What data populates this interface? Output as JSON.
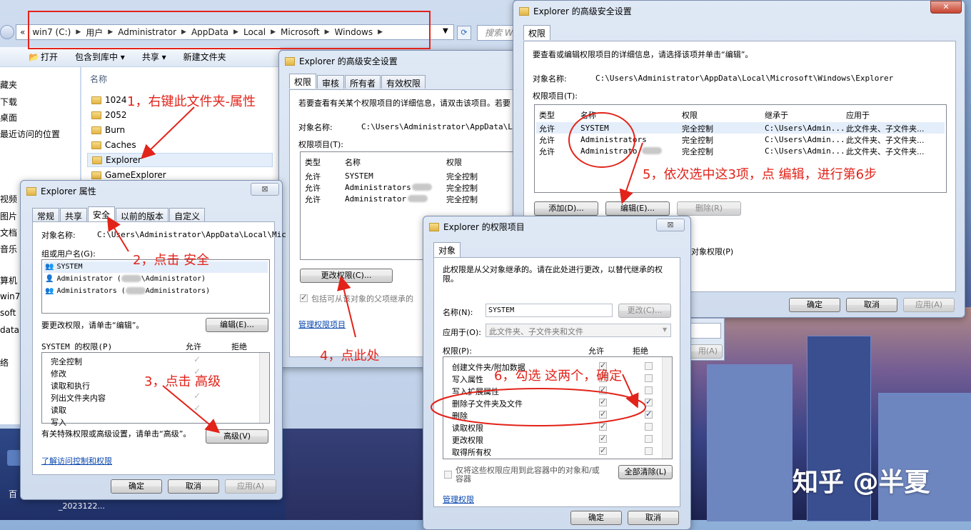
{
  "explorer": {
    "address_segments": [
      "win7 (C:)",
      "用户",
      "Administrator",
      "AppData",
      "Local",
      "Microsoft",
      "Windows"
    ],
    "address_prefix": "«",
    "search_placeholder": "搜索 W",
    "toolbar": [
      "打开",
      "包含到库中 ▾",
      "共享 ▾",
      "新建文件夹"
    ],
    "sidebar_items": [
      "藏夹",
      "下载",
      "桌面",
      "最近访问的位置",
      "视频",
      "图片",
      "文档",
      "音乐",
      "算机",
      "win7",
      "soft",
      "data",
      "络"
    ],
    "column_name": "名称",
    "files": [
      "1024",
      "2052",
      "Burn",
      "Caches",
      "Explorer",
      "GameExplorer"
    ],
    "taskbar_labels": [
      "百",
      "_2023122..."
    ]
  },
  "props_dialog": {
    "title": "Explorer 属性",
    "close": "⊠",
    "tabs": [
      "常规",
      "共享",
      "安全",
      "以前的版本",
      "自定义"
    ],
    "object_label": "对象名称:",
    "object_path": "C:\\Users\\Administrator\\AppData\\Local\\Mic",
    "group_label": "组或用户名(G):",
    "users": [
      "SYSTEM",
      "Administrator (",
      "Administrators ("
    ],
    "users_suffix": [
      "",
      "\\Administrator)",
      "Administrators)"
    ],
    "edit_hint": "要更改权限，请单击“编辑”。",
    "edit_button": "编辑(E)...",
    "perm_label": "SYSTEM 的权限(P)",
    "allow": "允许",
    "deny": "拒绝",
    "perms": [
      "完全控制",
      "修改",
      "读取和执行",
      "列出文件夹内容",
      "读取",
      "写入"
    ],
    "advanced_hint": "有关特殊权限或高级设置，请单击“高级”。",
    "advanced_button": "高级(V)",
    "learn_link": "了解访问控制和权限",
    "ok": "确定",
    "cancel": "取消",
    "apply": "应用(A)"
  },
  "adv_dialog1": {
    "title": "Explorer 的高级安全设置",
    "tabs": [
      "权限",
      "审核",
      "所有者",
      "有效权限"
    ],
    "hint": "若要查看有关某个权限项目的详细信息，请双击该项目。若要",
    "object_label": "对象名称:",
    "object_path": "C:\\Users\\Administrator\\AppData\\Local",
    "entries_label": "权限项目(T):",
    "col_type": "类型",
    "col_name": "名称",
    "col_perm": "权限",
    "rows": [
      {
        "type": "允许",
        "name": "SYSTEM",
        "perm": "完全控制"
      },
      {
        "type": "允许",
        "name": "Administrators",
        "perm": "完全控制"
      },
      {
        "type": "允许",
        "name": "Administrator",
        "perm": "完全控制"
      }
    ],
    "change_button": "更改权限(C)...",
    "inherit_text": "包括可从该对象的父项继承的",
    "manage_link": "管理权限项目"
  },
  "adv_dialog2": {
    "title": "Explorer 的高级安全设置",
    "tab": "权限",
    "hint": "要查看或编辑权限项目的详细信息，请选择该项并单击“编辑”。",
    "object_label": "对象名称:",
    "object_path": "C:\\Users\\Administrator\\AppData\\Local\\Microsoft\\Windows\\Explorer",
    "entries_label": "权限项目(T):",
    "cols": [
      "类型",
      "名称",
      "权限",
      "继承于",
      "应用于"
    ],
    "rows": [
      {
        "type": "允许",
        "name": "SYSTEM",
        "perm": "完全控制",
        "inherit": "C:\\Users\\Admin...",
        "apply": "此文件夹、子文件夹..."
      },
      {
        "type": "允许",
        "name": "Administrators",
        "perm": "完全控制",
        "inherit": "C:\\Users\\Admin...",
        "apply": "此文件夹、子文件夹..."
      },
      {
        "type": "允许",
        "name": "Administrato",
        "perm": "完全控制",
        "inherit": "C:\\Users\\Admin...",
        "apply": "此文件夹、子文件夹..."
      }
    ],
    "add_button": "添加(D)...",
    "edit_button": "编辑(E)...",
    "delete_button": "删除(R)",
    "replace_text": "对象权限(P)",
    "ok": "确定",
    "cancel": "取消",
    "apply": "应用(A)",
    "behind_apply": "用(A)"
  },
  "perm_entry_dialog": {
    "title": "Explorer 的权限项目",
    "close": "⊠",
    "tab": "对象",
    "inherit_note": "此权限是从父对象继承的。请在此处进行更改，以替代继承的权限。",
    "name_label": "名称(N):",
    "name_value": "SYSTEM",
    "change_button": "更改(C)...",
    "apply_label": "应用于(O):",
    "apply_value": "此文件夹、子文件夹和文件",
    "perm_label": "权限(P):",
    "allow": "允许",
    "deny": "拒绝",
    "perms": [
      "创建文件夹/附加数据",
      "写入属性",
      "写入扩展属性",
      "删除子文件夹及文件",
      "删除",
      "读取权限",
      "更改权限",
      "取得所有权"
    ],
    "deny_checked": [
      false,
      false,
      false,
      true,
      true,
      false,
      false,
      false
    ],
    "only_apply": "仅将这些权限应用到此容器中的对象和/或容器",
    "clear_all": "全部清除(L)",
    "manage_link": "管理权限",
    "ok": "确定",
    "cancel": "取消"
  },
  "annotations": {
    "step1": "1，右键此文件夹-属性",
    "step2": "2，点击 安全",
    "step3": "3，点击 高级",
    "step4": "4，点此处",
    "step5": "5，依次选中这3项，点 编辑，进行第6步",
    "step6": "6，勾选 这两个，确定",
    "color": "#e2231a"
  },
  "watermark": "知乎 @半夏"
}
